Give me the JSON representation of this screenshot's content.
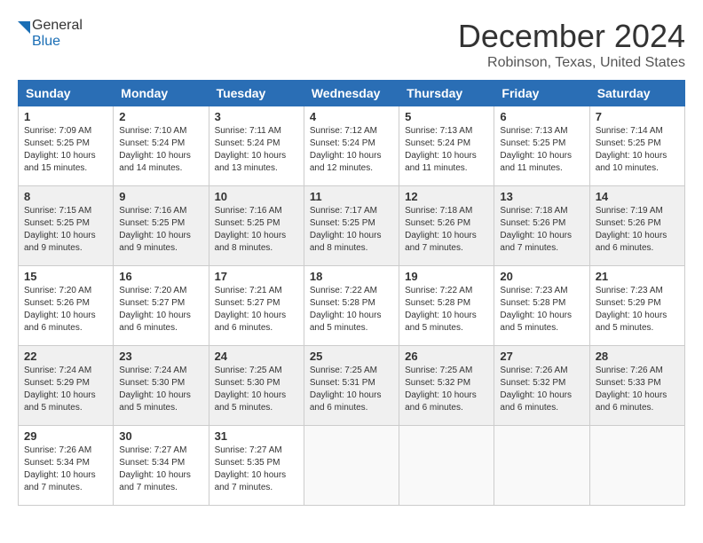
{
  "logo": {
    "text_general": "General",
    "text_blue": "Blue"
  },
  "title": "December 2024",
  "location": "Robinson, Texas, United States",
  "days_of_week": [
    "Sunday",
    "Monday",
    "Tuesday",
    "Wednesday",
    "Thursday",
    "Friday",
    "Saturday"
  ],
  "weeks": [
    {
      "shaded": false,
      "days": [
        {
          "num": "1",
          "info": "Sunrise: 7:09 AM\nSunset: 5:25 PM\nDaylight: 10 hours\nand 15 minutes."
        },
        {
          "num": "2",
          "info": "Sunrise: 7:10 AM\nSunset: 5:24 PM\nDaylight: 10 hours\nand 14 minutes."
        },
        {
          "num": "3",
          "info": "Sunrise: 7:11 AM\nSunset: 5:24 PM\nDaylight: 10 hours\nand 13 minutes."
        },
        {
          "num": "4",
          "info": "Sunrise: 7:12 AM\nSunset: 5:24 PM\nDaylight: 10 hours\nand 12 minutes."
        },
        {
          "num": "5",
          "info": "Sunrise: 7:13 AM\nSunset: 5:24 PM\nDaylight: 10 hours\nand 11 minutes."
        },
        {
          "num": "6",
          "info": "Sunrise: 7:13 AM\nSunset: 5:25 PM\nDaylight: 10 hours\nand 11 minutes."
        },
        {
          "num": "7",
          "info": "Sunrise: 7:14 AM\nSunset: 5:25 PM\nDaylight: 10 hours\nand 10 minutes."
        }
      ]
    },
    {
      "shaded": true,
      "days": [
        {
          "num": "8",
          "info": "Sunrise: 7:15 AM\nSunset: 5:25 PM\nDaylight: 10 hours\nand 9 minutes."
        },
        {
          "num": "9",
          "info": "Sunrise: 7:16 AM\nSunset: 5:25 PM\nDaylight: 10 hours\nand 9 minutes."
        },
        {
          "num": "10",
          "info": "Sunrise: 7:16 AM\nSunset: 5:25 PM\nDaylight: 10 hours\nand 8 minutes."
        },
        {
          "num": "11",
          "info": "Sunrise: 7:17 AM\nSunset: 5:25 PM\nDaylight: 10 hours\nand 8 minutes."
        },
        {
          "num": "12",
          "info": "Sunrise: 7:18 AM\nSunset: 5:26 PM\nDaylight: 10 hours\nand 7 minutes."
        },
        {
          "num": "13",
          "info": "Sunrise: 7:18 AM\nSunset: 5:26 PM\nDaylight: 10 hours\nand 7 minutes."
        },
        {
          "num": "14",
          "info": "Sunrise: 7:19 AM\nSunset: 5:26 PM\nDaylight: 10 hours\nand 6 minutes."
        }
      ]
    },
    {
      "shaded": false,
      "days": [
        {
          "num": "15",
          "info": "Sunrise: 7:20 AM\nSunset: 5:26 PM\nDaylight: 10 hours\nand 6 minutes."
        },
        {
          "num": "16",
          "info": "Sunrise: 7:20 AM\nSunset: 5:27 PM\nDaylight: 10 hours\nand 6 minutes."
        },
        {
          "num": "17",
          "info": "Sunrise: 7:21 AM\nSunset: 5:27 PM\nDaylight: 10 hours\nand 6 minutes."
        },
        {
          "num": "18",
          "info": "Sunrise: 7:22 AM\nSunset: 5:28 PM\nDaylight: 10 hours\nand 5 minutes."
        },
        {
          "num": "19",
          "info": "Sunrise: 7:22 AM\nSunset: 5:28 PM\nDaylight: 10 hours\nand 5 minutes."
        },
        {
          "num": "20",
          "info": "Sunrise: 7:23 AM\nSunset: 5:28 PM\nDaylight: 10 hours\nand 5 minutes."
        },
        {
          "num": "21",
          "info": "Sunrise: 7:23 AM\nSunset: 5:29 PM\nDaylight: 10 hours\nand 5 minutes."
        }
      ]
    },
    {
      "shaded": true,
      "days": [
        {
          "num": "22",
          "info": "Sunrise: 7:24 AM\nSunset: 5:29 PM\nDaylight: 10 hours\nand 5 minutes."
        },
        {
          "num": "23",
          "info": "Sunrise: 7:24 AM\nSunset: 5:30 PM\nDaylight: 10 hours\nand 5 minutes."
        },
        {
          "num": "24",
          "info": "Sunrise: 7:25 AM\nSunset: 5:30 PM\nDaylight: 10 hours\nand 5 minutes."
        },
        {
          "num": "25",
          "info": "Sunrise: 7:25 AM\nSunset: 5:31 PM\nDaylight: 10 hours\nand 6 minutes."
        },
        {
          "num": "26",
          "info": "Sunrise: 7:25 AM\nSunset: 5:32 PM\nDaylight: 10 hours\nand 6 minutes."
        },
        {
          "num": "27",
          "info": "Sunrise: 7:26 AM\nSunset: 5:32 PM\nDaylight: 10 hours\nand 6 minutes."
        },
        {
          "num": "28",
          "info": "Sunrise: 7:26 AM\nSunset: 5:33 PM\nDaylight: 10 hours\nand 6 minutes."
        }
      ]
    },
    {
      "shaded": false,
      "days": [
        {
          "num": "29",
          "info": "Sunrise: 7:26 AM\nSunset: 5:34 PM\nDaylight: 10 hours\nand 7 minutes."
        },
        {
          "num": "30",
          "info": "Sunrise: 7:27 AM\nSunset: 5:34 PM\nDaylight: 10 hours\nand 7 minutes."
        },
        {
          "num": "31",
          "info": "Sunrise: 7:27 AM\nSunset: 5:35 PM\nDaylight: 10 hours\nand 7 minutes."
        },
        {
          "num": "",
          "info": ""
        },
        {
          "num": "",
          "info": ""
        },
        {
          "num": "",
          "info": ""
        },
        {
          "num": "",
          "info": ""
        }
      ]
    }
  ]
}
